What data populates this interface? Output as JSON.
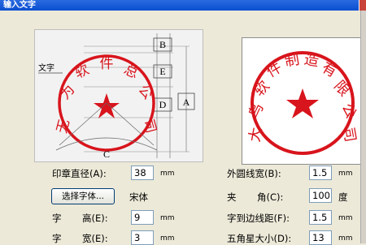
{
  "window": {
    "title": "输入文字"
  },
  "diagram": {
    "label_text": "文字",
    "label_B": "B",
    "label_E": "E",
    "label_D": "D",
    "label_A": "A",
    "label_C": "C",
    "stamp_text": [
      "无",
      "为",
      "软",
      "件",
      "总",
      "公",
      "司"
    ]
  },
  "preview": {
    "stamp_text": "大乌软件制造有限公司",
    "stamp_color": "#d8141c"
  },
  "form": {
    "diameter_label": "印章直径(A):",
    "diameter_value": "38",
    "diameter_unit": "mm",
    "font_button": "选择字体...",
    "font_name": "宋体",
    "char_height_label_a": "字",
    "char_height_label_b": "高(E):",
    "char_height_value": "9",
    "char_height_unit": "mm",
    "char_width_label_a": "字",
    "char_width_label_b": "宽(E):",
    "char_width_value": "3",
    "char_width_unit": "mm",
    "outer_width_label": "外圆线宽(B):",
    "outer_width_value": "1.5",
    "outer_width_unit": "mm",
    "angle_label_a": "夹",
    "angle_label_b": "角(C):",
    "angle_value": "100",
    "angle_unit": "度",
    "edge_dist_label": "字到边线距(F):",
    "edge_dist_value": "1.5",
    "edge_dist_unit": "mm",
    "star_label": "五角星大小(D):",
    "star_value": "13",
    "star_unit": "mm"
  }
}
